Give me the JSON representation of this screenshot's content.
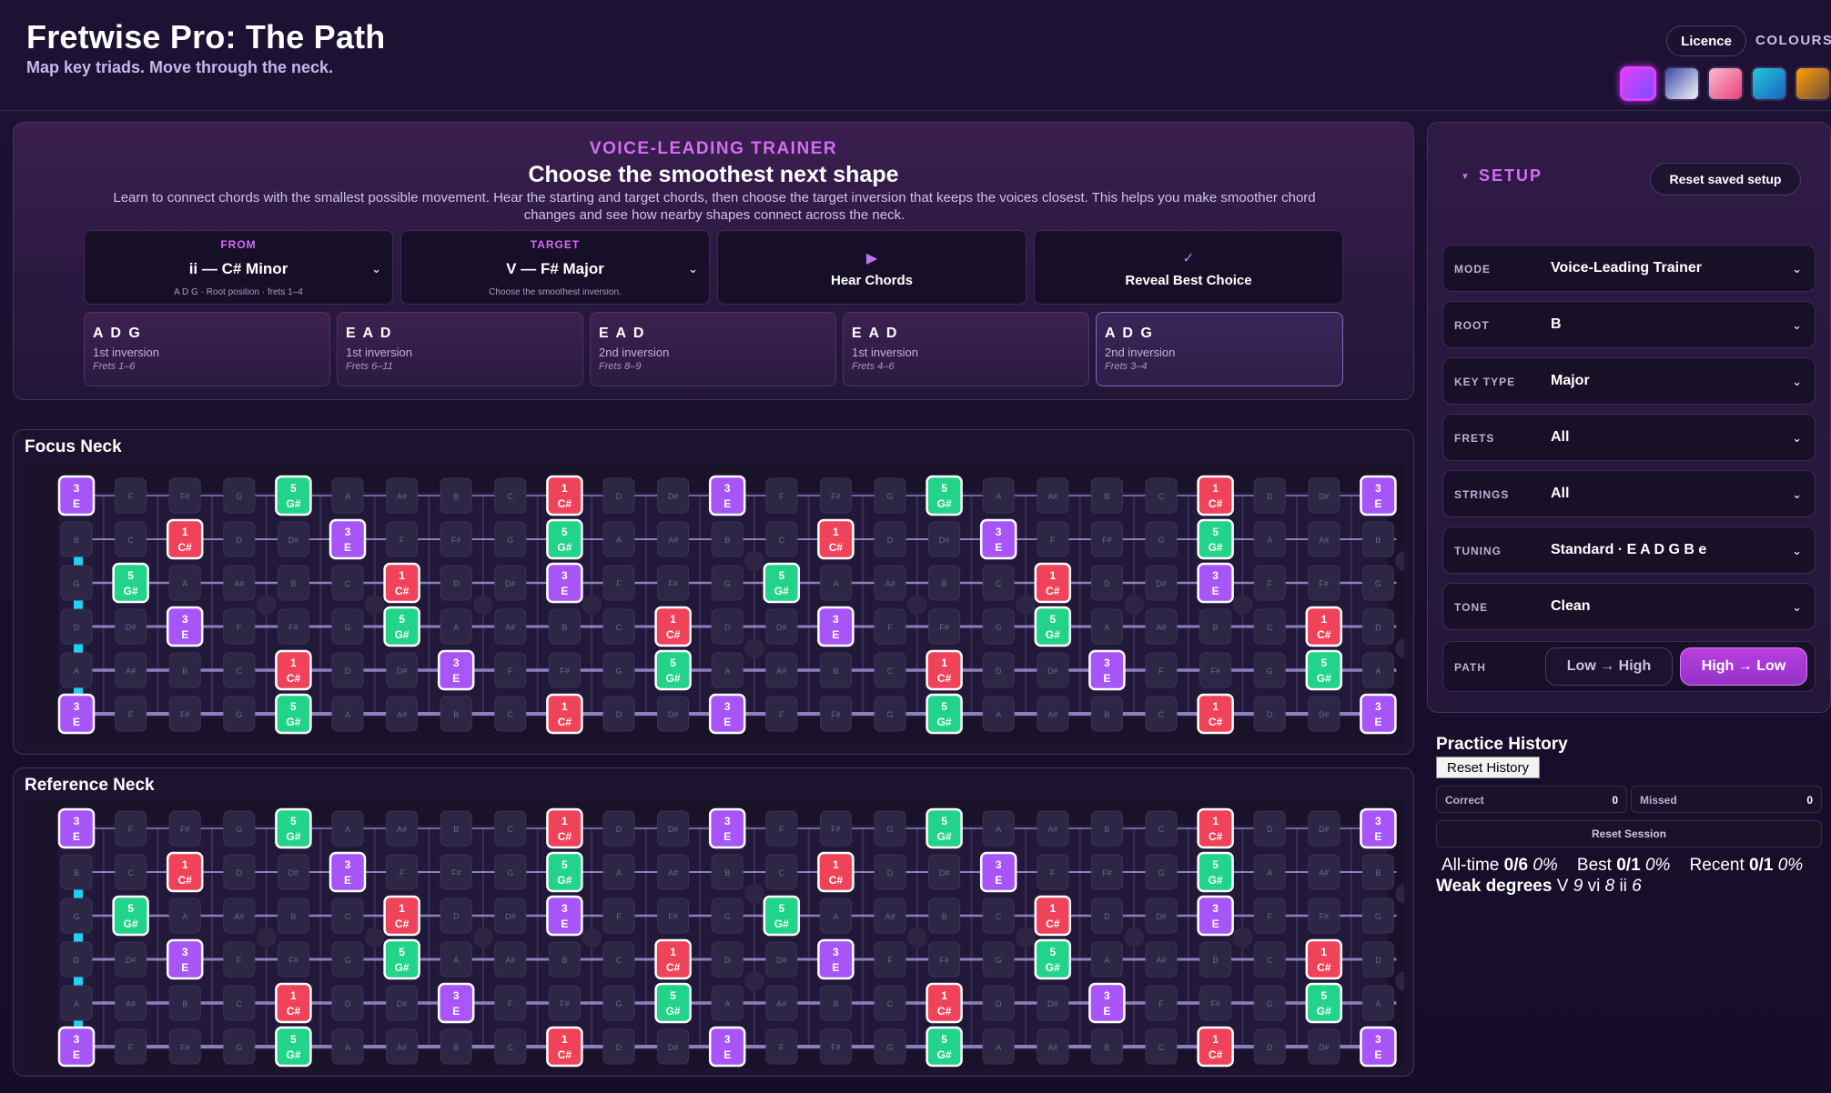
{
  "app": {
    "title": "Fretwise Pro: The Path",
    "subtitle": "Map key triads. Move through the neck."
  },
  "header": {
    "licence_label": "Licence",
    "colours_label": "COLOURS"
  },
  "trainer": {
    "kicker": "VOICE-LEADING TRAINER",
    "title": "Choose the smoothest next shape",
    "description": "Learn to connect chords with the smallest possible movement. Hear the starting and target chords, then choose the target inversion that keeps the voices closest. This helps you make smoother chord changes and see how nearby shapes connect across the neck.",
    "from": {
      "label": "FROM",
      "value": "ii — C# Minor",
      "sub": "A D G · Root position · frets 1–4"
    },
    "target": {
      "label": "TARGET",
      "value": "V — F# Major",
      "sub": "Choose the smoothest inversion."
    },
    "hear_label": "Hear Chords",
    "reveal_label": "Reveal Best Choice",
    "options": [
      {
        "strings": "A D G",
        "inversion": "1st inversion",
        "frets": "Frets 1–6"
      },
      {
        "strings": "E A D",
        "inversion": "1st inversion",
        "frets": "Frets 6–11"
      },
      {
        "strings": "E A D",
        "inversion": "2nd inversion",
        "frets": "Frets 8–9"
      },
      {
        "strings": "E A D",
        "inversion": "1st inversion",
        "frets": "Frets 4–6"
      },
      {
        "strings": "A D G",
        "inversion": "2nd inversion",
        "frets": "Frets 3–4"
      }
    ]
  },
  "setup": {
    "title": "SETUP",
    "reset_label": "Reset saved setup",
    "rows": [
      {
        "label": "MODE",
        "value": "Voice-Leading Trainer"
      },
      {
        "label": "ROOT",
        "value": "B"
      },
      {
        "label": "KEY TYPE",
        "value": "Major"
      },
      {
        "label": "FRETS",
        "value": "All"
      },
      {
        "label": "STRINGS",
        "value": "All"
      },
      {
        "label": "TUNING",
        "value": "Standard · E A D G B e"
      },
      {
        "label": "TONE",
        "value": "Clean"
      }
    ],
    "path": {
      "label": "PATH",
      "options": [
        "Low → High",
        "High → Low"
      ],
      "selected": 1
    }
  },
  "history": {
    "title": "Practice History",
    "reset_label": "Reset History",
    "correct_label": "Correct",
    "correct": "0",
    "missed_label": "Missed",
    "missed": "0",
    "session_label": "Reset Session",
    "alltime_label": "All-time",
    "alltime": "0/6",
    "alltime_pct": "0%",
    "best_label": "Best",
    "best": "0/1",
    "best_pct": "0%",
    "recent_label": "Recent",
    "recent": "0/1",
    "recent_pct": "0%",
    "weak_label": "Weak degrees",
    "weak": [
      {
        "d": "V",
        "n": "9"
      },
      {
        "d": "vi",
        "n": "8"
      },
      {
        "d": "ii",
        "n": "6"
      }
    ]
  },
  "necks": {
    "focus_title": "Focus Neck",
    "reference_title": "Reference Neck",
    "colors": {
      "degree1": "#f0435a",
      "degree3": "#a855f7",
      "degree5": "#22d38a",
      "ghost": "#2d2645",
      "rail": "#1fd3f0"
    },
    "strings_top_to_bottom": [
      {
        "name": "e",
        "notes": [
          {
            "f": 0,
            "n": "E",
            "d": "3"
          },
          {
            "f": 1,
            "n": "F"
          },
          {
            "f": 2,
            "n": "F#"
          },
          {
            "f": 3,
            "n": "G"
          },
          {
            "f": 4,
            "n": "G#",
            "d": "5"
          },
          {
            "f": 5,
            "n": "A"
          },
          {
            "f": 6,
            "n": "A#"
          },
          {
            "f": 7,
            "n": "B"
          },
          {
            "f": 8,
            "n": "C"
          },
          {
            "f": 9,
            "n": "C#",
            "d": "1"
          },
          {
            "f": 10,
            "n": "D"
          },
          {
            "f": 11,
            "n": "D#"
          },
          {
            "f": 12,
            "n": "E",
            "d": "3"
          },
          {
            "f": 13,
            "n": "F"
          },
          {
            "f": 14,
            "n": "F#"
          },
          {
            "f": 15,
            "n": "G"
          },
          {
            "f": 16,
            "n": "G#",
            "d": "5"
          },
          {
            "f": 17,
            "n": "A"
          },
          {
            "f": 18,
            "n": "A#"
          },
          {
            "f": 19,
            "n": "B"
          },
          {
            "f": 20,
            "n": "C"
          },
          {
            "f": 21,
            "n": "C#",
            "d": "1"
          },
          {
            "f": 22,
            "n": "D"
          },
          {
            "f": 23,
            "n": "D#"
          },
          {
            "f": 24,
            "n": "E",
            "d": "3"
          }
        ]
      },
      {
        "name": "B",
        "notes": [
          {
            "f": 0,
            "n": "B"
          },
          {
            "f": 1,
            "n": "C"
          },
          {
            "f": 2,
            "n": "C#",
            "d": "1"
          },
          {
            "f": 3,
            "n": "D"
          },
          {
            "f": 4,
            "n": "D#"
          },
          {
            "f": 5,
            "n": "E",
            "d": "3"
          },
          {
            "f": 6,
            "n": "F"
          },
          {
            "f": 7,
            "n": "F#"
          },
          {
            "f": 8,
            "n": "G"
          },
          {
            "f": 9,
            "n": "G#",
            "d": "5"
          },
          {
            "f": 10,
            "n": "A"
          },
          {
            "f": 11,
            "n": "A#"
          },
          {
            "f": 12,
            "n": "B"
          },
          {
            "f": 13,
            "n": "C"
          },
          {
            "f": 14,
            "n": "C#",
            "d": "1"
          },
          {
            "f": 15,
            "n": "D"
          },
          {
            "f": 16,
            "n": "D#"
          },
          {
            "f": 17,
            "n": "E",
            "d": "3"
          },
          {
            "f": 18,
            "n": "F"
          },
          {
            "f": 19,
            "n": "F#"
          },
          {
            "f": 20,
            "n": "G"
          },
          {
            "f": 21,
            "n": "G#",
            "d": "5"
          },
          {
            "f": 22,
            "n": "A"
          },
          {
            "f": 23,
            "n": "A#"
          },
          {
            "f": 24,
            "n": "B"
          }
        ]
      },
      {
        "name": "G",
        "notes": [
          {
            "f": 0,
            "n": "G"
          },
          {
            "f": 1,
            "n": "G#",
            "d": "5"
          },
          {
            "f": 2,
            "n": "A"
          },
          {
            "f": 3,
            "n": "A#"
          },
          {
            "f": 4,
            "n": "B"
          },
          {
            "f": 5,
            "n": "C"
          },
          {
            "f": 6,
            "n": "C#",
            "d": "1"
          },
          {
            "f": 7,
            "n": "D"
          },
          {
            "f": 8,
            "n": "D#"
          },
          {
            "f": 9,
            "n": "E",
            "d": "3"
          },
          {
            "f": 10,
            "n": "F"
          },
          {
            "f": 11,
            "n": "F#"
          },
          {
            "f": 12,
            "n": "G"
          },
          {
            "f": 13,
            "n": "G#",
            "d": "5"
          },
          {
            "f": 14,
            "n": "A"
          },
          {
            "f": 15,
            "n": "A#"
          },
          {
            "f": 16,
            "n": "B"
          },
          {
            "f": 17,
            "n": "C"
          },
          {
            "f": 18,
            "n": "C#",
            "d": "1"
          },
          {
            "f": 19,
            "n": "D"
          },
          {
            "f": 20,
            "n": "D#"
          },
          {
            "f": 21,
            "n": "E",
            "d": "3"
          },
          {
            "f": 22,
            "n": "F"
          },
          {
            "f": 23,
            "n": "F#"
          },
          {
            "f": 24,
            "n": "G"
          }
        ]
      },
      {
        "name": "D",
        "notes": [
          {
            "f": 0,
            "n": "D"
          },
          {
            "f": 1,
            "n": "D#"
          },
          {
            "f": 2,
            "n": "E",
            "d": "3"
          },
          {
            "f": 3,
            "n": "F"
          },
          {
            "f": 4,
            "n": "F#"
          },
          {
            "f": 5,
            "n": "G"
          },
          {
            "f": 6,
            "n": "G#",
            "d": "5"
          },
          {
            "f": 7,
            "n": "A"
          },
          {
            "f": 8,
            "n": "A#"
          },
          {
            "f": 9,
            "n": "B"
          },
          {
            "f": 10,
            "n": "C"
          },
          {
            "f": 11,
            "n": "C#",
            "d": "1"
          },
          {
            "f": 12,
            "n": "D"
          },
          {
            "f": 13,
            "n": "D#"
          },
          {
            "f": 14,
            "n": "E",
            "d": "3"
          },
          {
            "f": 15,
            "n": "F"
          },
          {
            "f": 16,
            "n": "F#"
          },
          {
            "f": 17,
            "n": "G"
          },
          {
            "f": 18,
            "n": "G#",
            "d": "5"
          },
          {
            "f": 19,
            "n": "A"
          },
          {
            "f": 20,
            "n": "A#"
          },
          {
            "f": 21,
            "n": "B"
          },
          {
            "f": 22,
            "n": "C"
          },
          {
            "f": 23,
            "n": "C#",
            "d": "1"
          },
          {
            "f": 24,
            "n": "D"
          }
        ]
      },
      {
        "name": "A",
        "notes": [
          {
            "f": 0,
            "n": "A"
          },
          {
            "f": 1,
            "n": "A#"
          },
          {
            "f": 2,
            "n": "B"
          },
          {
            "f": 3,
            "n": "C"
          },
          {
            "f": 4,
            "n": "C#",
            "d": "1"
          },
          {
            "f": 5,
            "n": "D"
          },
          {
            "f": 6,
            "n": "D#"
          },
          {
            "f": 7,
            "n": "E",
            "d": "3"
          },
          {
            "f": 8,
            "n": "F"
          },
          {
            "f": 9,
            "n": "F#"
          },
          {
            "f": 10,
            "n": "G"
          },
          {
            "f": 11,
            "n": "G#",
            "d": "5"
          },
          {
            "f": 12,
            "n": "A"
          },
          {
            "f": 13,
            "n": "A#"
          },
          {
            "f": 14,
            "n": "B"
          },
          {
            "f": 15,
            "n": "C"
          },
          {
            "f": 16,
            "n": "C#",
            "d": "1"
          },
          {
            "f": 17,
            "n": "D"
          },
          {
            "f": 18,
            "n": "D#"
          },
          {
            "f": 19,
            "n": "E",
            "d": "3"
          },
          {
            "f": 20,
            "n": "F"
          },
          {
            "f": 21,
            "n": "F#"
          },
          {
            "f": 22,
            "n": "G"
          },
          {
            "f": 23,
            "n": "G#",
            "d": "5"
          },
          {
            "f": 24,
            "n": "A"
          }
        ]
      },
      {
        "name": "E",
        "notes": [
          {
            "f": 0,
            "n": "E",
            "d": "3"
          },
          {
            "f": 1,
            "n": "F"
          },
          {
            "f": 2,
            "n": "F#"
          },
          {
            "f": 3,
            "n": "G"
          },
          {
            "f": 4,
            "n": "G#",
            "d": "5"
          },
          {
            "f": 5,
            "n": "A"
          },
          {
            "f": 6,
            "n": "A#"
          },
          {
            "f": 7,
            "n": "B"
          },
          {
            "f": 8,
            "n": "C"
          },
          {
            "f": 9,
            "n": "C#",
            "d": "1"
          },
          {
            "f": 10,
            "n": "D"
          },
          {
            "f": 11,
            "n": "D#"
          },
          {
            "f": 12,
            "n": "E",
            "d": "3"
          },
          {
            "f": 13,
            "n": "F"
          },
          {
            "f": 14,
            "n": "F#"
          },
          {
            "f": 15,
            "n": "G"
          },
          {
            "f": 16,
            "n": "G#",
            "d": "5"
          },
          {
            "f": 17,
            "n": "A"
          },
          {
            "f": 18,
            "n": "A#"
          },
          {
            "f": 19,
            "n": "B"
          },
          {
            "f": 20,
            "n": "C"
          },
          {
            "f": 21,
            "n": "C#",
            "d": "1"
          },
          {
            "f": 22,
            "n": "D"
          },
          {
            "f": 23,
            "n": "D#"
          },
          {
            "f": 24,
            "n": "E",
            "d": "3"
          }
        ]
      }
    ],
    "inlay_frets": [
      3,
      5,
      7,
      9,
      15,
      17,
      19,
      21
    ],
    "double_inlay_frets": [
      12,
      24
    ]
  },
  "swatches": [
    {
      "name": "magenta-theme",
      "from": "#e040fb",
      "to": "#7c4dff",
      "active": true
    },
    {
      "name": "blue-white-theme",
      "from": "#3949ab",
      "to": "#f5f5f5",
      "active": false
    },
    {
      "name": "pink-theme",
      "from": "#f8bbd0",
      "to": "#ec407a",
      "active": false
    },
    {
      "name": "cyan-theme",
      "from": "#26c6da",
      "to": "#1565c0",
      "active": false
    },
    {
      "name": "amber-theme",
      "from": "#ffa000",
      "to": "#6d4c41",
      "active": false
    }
  ]
}
